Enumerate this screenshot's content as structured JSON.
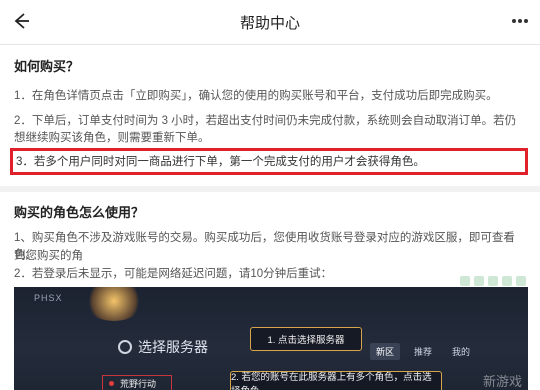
{
  "header": {
    "title": "帮助中心",
    "back_icon": "back-arrow-icon",
    "more_icon": "more-dots-icon"
  },
  "section1": {
    "title": "如何购买？",
    "p1": "1．在角色详情页点击「立即购买」，确认您的使用的购买账号和平台，支付成功后即完成购买。",
    "p2_line1": "2．下单后，订单支付时间为 3 小时，若超出支付时间仍未完成付款，系统则会自动取消订单。若仍",
    "p2_line2": "想继续购买该角色，则需要重新下单。",
    "p3": "3．若多个用户同时对同一商品进行下单，第一个完成支付的用户才会获得角色。"
  },
  "section2": {
    "title": "购买的角色怎么使用？",
    "p1_line1": "1、购买角色不涉及游戏账号的交易。购买成功后，您使用收货账号登录对应的游戏区服，即可查看到您购买的角",
    "p1_line2": "色。",
    "p2": "2．若登录后未显示，可能是网络延迟问题，请10分钟后重试："
  },
  "game_screenshot": {
    "logo": "PHSX",
    "server_label": "选择服务器",
    "step1": "1. 点击选择服务器",
    "step2": "2. 若您的账号在此服务器上有多个角色，点击选择角色",
    "tabs": [
      "新区",
      "推荐",
      "我的"
    ],
    "item": "荒野行动",
    "watermark": "新游戏"
  },
  "colors": {
    "highlight_border": "#e0202a",
    "accent_gold": "#d9a54a"
  }
}
